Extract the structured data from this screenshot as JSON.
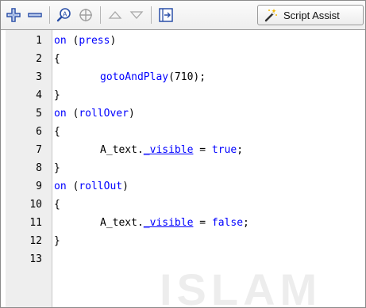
{
  "toolbar": {
    "buttons": [
      {
        "icon": "add-statement-icon"
      },
      {
        "icon": "delete-statement-icon"
      },
      {
        "icon": "find-icon"
      },
      {
        "icon": "insert-target-icon"
      },
      {
        "icon": "move-up-icon"
      },
      {
        "icon": "move-down-icon"
      },
      {
        "icon": "check-syntax-icon"
      }
    ],
    "script_assist_label": "Script Assist"
  },
  "code_lines": [
    {
      "n": "1",
      "text": "on (press)"
    },
    {
      "n": "2",
      "text": "{"
    },
    {
      "n": "3",
      "text": "gotoAndPlay(710);"
    },
    {
      "n": "4",
      "text": "}"
    },
    {
      "n": "5",
      "text": "on (rollOver)"
    },
    {
      "n": "6",
      "text": "{"
    },
    {
      "n": "7",
      "text": "A_text._visible = true;"
    },
    {
      "n": "8",
      "text": "}"
    },
    {
      "n": "9",
      "text": "on (rollOut)"
    },
    {
      "n": "10",
      "text": "{"
    },
    {
      "n": "11",
      "text": "A_text._visible = false;"
    },
    {
      "n": "12",
      "text": "}"
    },
    {
      "n": "13",
      "text": ""
    }
  ],
  "watermark": "ISLAM",
  "colors": {
    "keyword": "#0000ff",
    "gutter": "#eeeeee"
  }
}
